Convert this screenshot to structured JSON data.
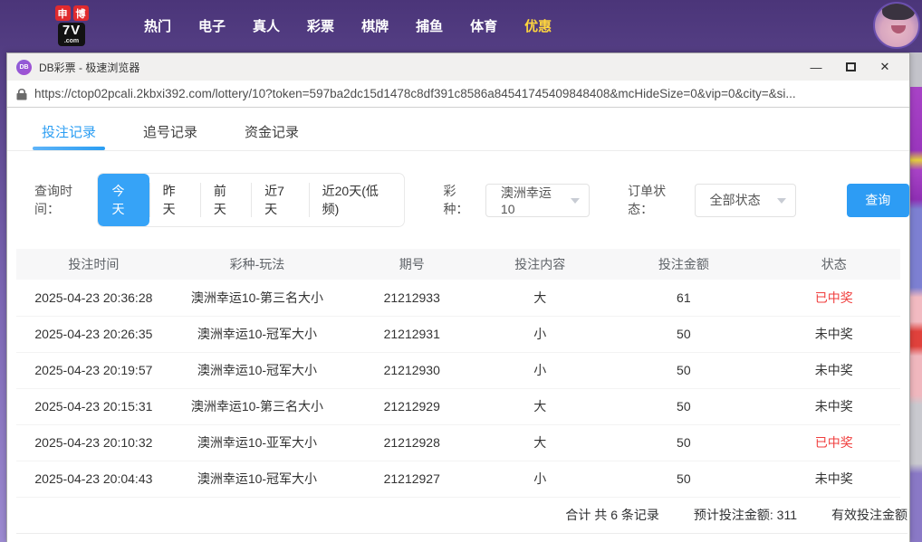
{
  "nav": {
    "logo": {
      "badge1": "申",
      "badge2": "博",
      "name": "7V",
      "suffix": ".com"
    },
    "items": [
      {
        "label": "热门"
      },
      {
        "label": "电子"
      },
      {
        "label": "真人"
      },
      {
        "label": "彩票"
      },
      {
        "label": "棋牌"
      },
      {
        "label": "捕鱼"
      },
      {
        "label": "体育"
      },
      {
        "label": "优惠"
      }
    ]
  },
  "window": {
    "favicon_text": "DB",
    "title": "DB彩票 - 极速浏览器",
    "controls": {
      "minimize": "—",
      "close": "✕"
    },
    "url": "https://ctop02pcali.2kbxi392.com/lottery/10?token=597ba2dc15d1478c8df391c8586a84541745409848408&mcHideSize=0&vip=0&city=&si..."
  },
  "tabs": [
    {
      "label": "投注记录",
      "active": true
    },
    {
      "label": "追号记录",
      "active": false
    },
    {
      "label": "资金记录",
      "active": false
    }
  ],
  "filters": {
    "time_label": "查询时间：",
    "time_options": [
      "今天",
      "昨天",
      "前天",
      "近7天",
      "近20天(低频)"
    ],
    "time_active": "今天",
    "lottery_label": "彩种：",
    "lottery_value": "澳洲幸运10",
    "status_label": "订单状态：",
    "status_value": "全部状态",
    "query_button": "查询"
  },
  "table": {
    "headers": [
      "投注时间",
      "彩种-玩法",
      "期号",
      "投注内容",
      "投注金额",
      "状态"
    ],
    "rows": [
      {
        "time": "2025-04-23 20:36:28",
        "game": "澳洲幸运10-第三名大小",
        "issue": "21212933",
        "content": "大",
        "amount": "61",
        "status": "已中奖",
        "won": true
      },
      {
        "time": "2025-04-23 20:26:35",
        "game": "澳洲幸运10-冠军大小",
        "issue": "21212931",
        "content": "小",
        "amount": "50",
        "status": "未中奖",
        "won": false
      },
      {
        "time": "2025-04-23 20:19:57",
        "game": "澳洲幸运10-冠军大小",
        "issue": "21212930",
        "content": "小",
        "amount": "50",
        "status": "未中奖",
        "won": false
      },
      {
        "time": "2025-04-23 20:15:31",
        "game": "澳洲幸运10-第三名大小",
        "issue": "21212929",
        "content": "大",
        "amount": "50",
        "status": "未中奖",
        "won": false
      },
      {
        "time": "2025-04-23 20:10:32",
        "game": "澳洲幸运10-亚军大小",
        "issue": "21212928",
        "content": "大",
        "amount": "50",
        "status": "已中奖",
        "won": true
      },
      {
        "time": "2025-04-23 20:04:43",
        "game": "澳洲幸运10-冠军大小",
        "issue": "21212927",
        "content": "小",
        "amount": "50",
        "status": "未中奖",
        "won": false
      }
    ]
  },
  "footer": {
    "summary": "合计 共 6 条记录",
    "expected": "预计投注金额: 311",
    "valid": "有效投注金额"
  },
  "colors": {
    "accent_blue": "#2d9cf4",
    "active_tab_blue": "#2b9ef3",
    "won_red": "#f03e3d",
    "nav_highlight_yellow": "#ffd53e",
    "nav_purple": "#7c67b4"
  }
}
